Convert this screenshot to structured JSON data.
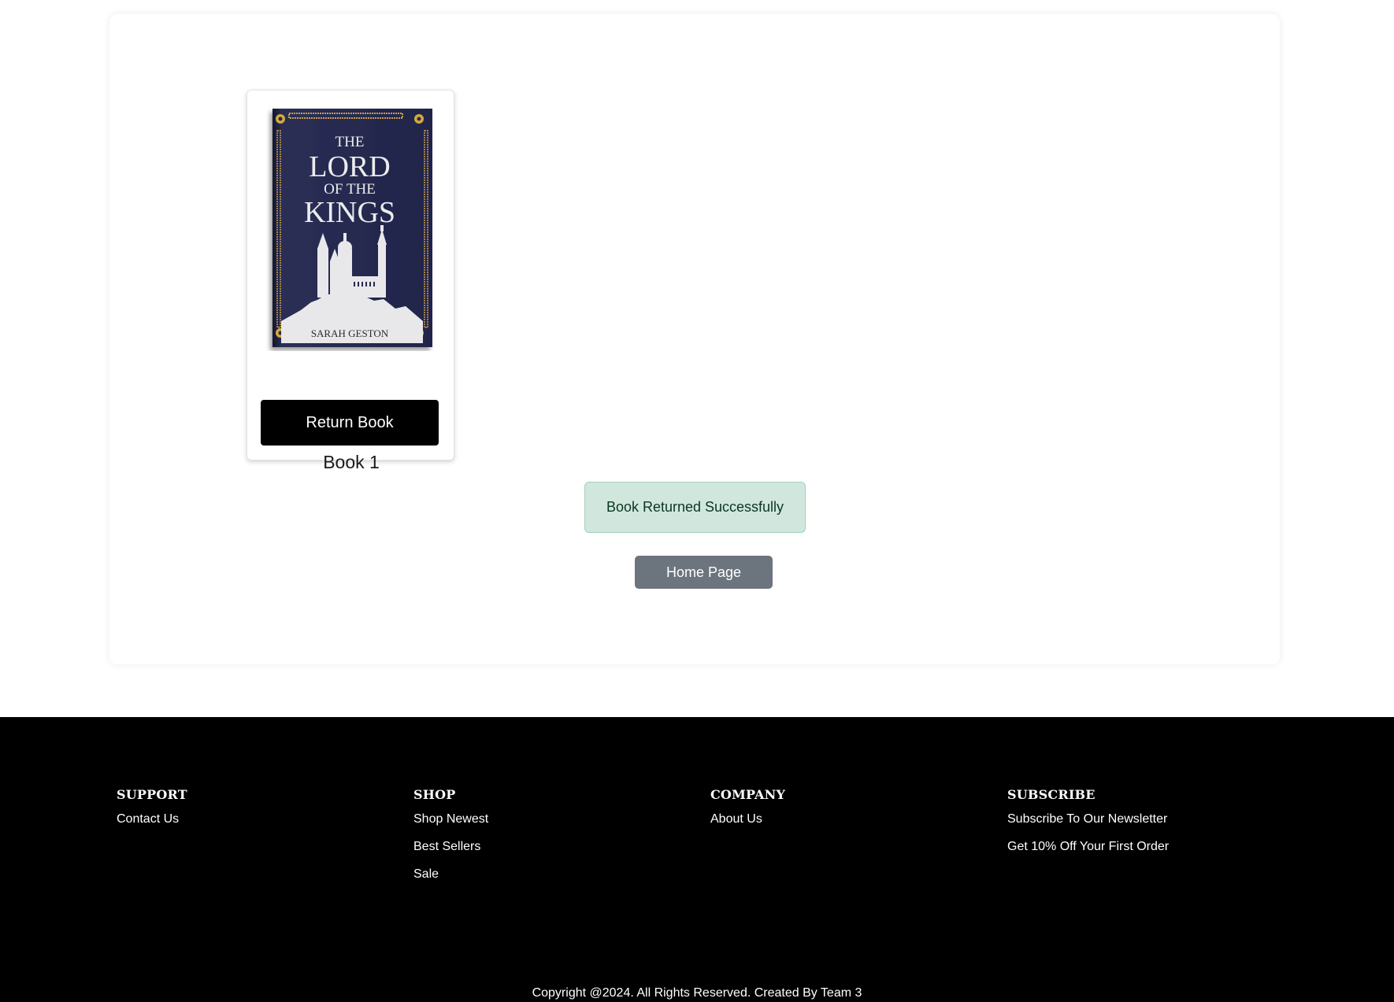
{
  "book": {
    "title": "Book 1",
    "cover": {
      "line1": "THE",
      "line2": "LORD",
      "line3": "OF THE",
      "line4": "KINGS",
      "author": "SARAH GESTON",
      "background_color": "#262a4e",
      "accent_color": "#c9a04a"
    },
    "return_label": "Return Book"
  },
  "alert": {
    "message": "Book Returned Successfully"
  },
  "home_button": {
    "label": "Home Page"
  },
  "footer": {
    "columns": [
      {
        "heading": "SUPPORT",
        "links": [
          "Contact Us"
        ]
      },
      {
        "heading": "SHOP",
        "links": [
          "Shop Newest",
          "Best Sellers",
          "Sale"
        ]
      },
      {
        "heading": "COMPANY",
        "links": [
          "About Us"
        ]
      },
      {
        "heading": "SUBSCRIBE",
        "links": [
          "Subscribe To Our Newsletter",
          "Get 10% Off Your First Order"
        ]
      }
    ],
    "copyright": "Copyright @2024. All Rights Reserved. Created By Team 3"
  }
}
